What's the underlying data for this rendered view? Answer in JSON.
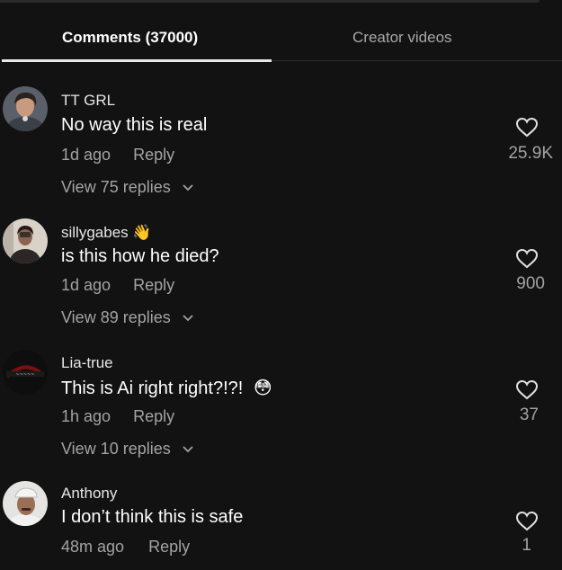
{
  "tabs": {
    "comments_label": "Comments (37000)",
    "creator_label": "Creator videos"
  },
  "comments": [
    {
      "username": "TT GRL",
      "text": "No way this is real",
      "time": "1d ago",
      "reply": "Reply",
      "view_replies": "View 75 replies",
      "likes": "25.9K",
      "avatar_icon": "avatar-photo"
    },
    {
      "username": "sillygabes",
      "username_emoji": "👋",
      "text": "is this how he died?",
      "time": "1d ago",
      "reply": "Reply",
      "view_replies": "View 89 replies",
      "likes": "900",
      "avatar_icon": "avatar-photo"
    },
    {
      "username": "Lia-true",
      "text": "This is Ai right right?!?!",
      "text_emoji": "😳",
      "time": "1h ago",
      "reply": "Reply",
      "view_replies": "View 10 replies",
      "likes": "37",
      "avatar_icon": "avatar-photo"
    },
    {
      "username": "Anthony",
      "text": "I don’t think this is safe",
      "time": "48m ago",
      "reply": "Reply",
      "likes": "1",
      "avatar_icon": "avatar-photo"
    }
  ],
  "colors": {
    "background": "#121212",
    "text_primary": "#ffffff",
    "text_secondary": "#a3a3a3",
    "tab_underline": "#e8e8e8"
  }
}
